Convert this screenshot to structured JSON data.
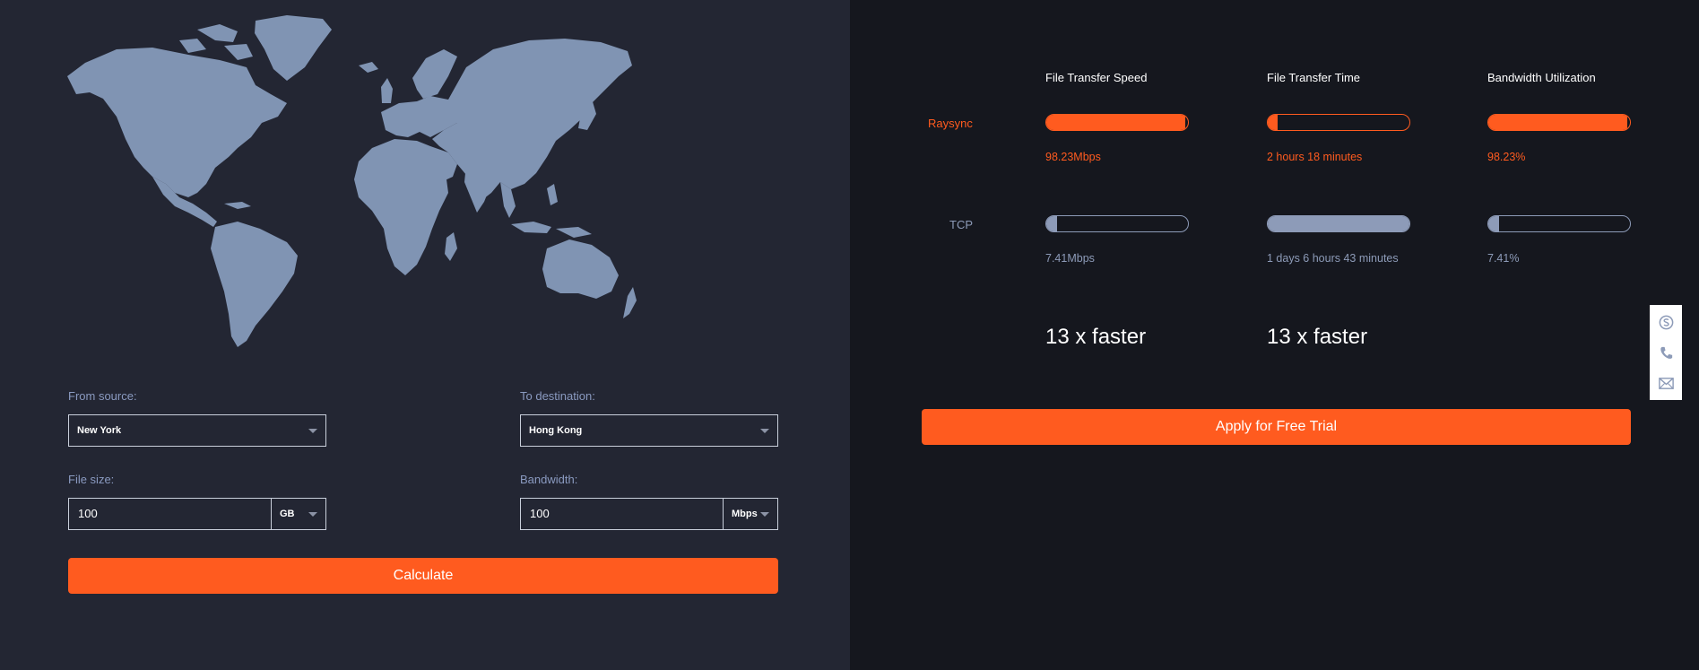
{
  "form": {
    "source_label": "From source:",
    "source_value": "New York",
    "destination_label": "To destination:",
    "destination_value": "Hong Kong",
    "filesize_label": "File size:",
    "filesize_value": "100",
    "filesize_unit": "GB",
    "bandwidth_label": "Bandwidth:",
    "bandwidth_value": "100",
    "bandwidth_unit": "Mbps",
    "calculate_label": "Calculate"
  },
  "results": {
    "columns": [
      "File Transfer Speed",
      "File Transfer Time",
      "Bandwidth Utilization"
    ],
    "raysync": {
      "label": "Raysync",
      "speed": "98.23Mbps",
      "time": "2 hours 18 minutes",
      "utilization": "98.23%",
      "speed_fill": 0.9823,
      "time_fill": 0.07,
      "utilization_fill": 0.9823
    },
    "tcp": {
      "label": "TCP",
      "speed": "7.41Mbps",
      "time": "1 days 6 hours 43 minutes",
      "utilization": "7.41%",
      "speed_fill": 0.0741,
      "time_fill": 1.0,
      "utilization_fill": 0.0741
    },
    "faster_speed": "13 x faster",
    "faster_time": "13 x faster",
    "trial_label": "Apply for Free Trial"
  },
  "side_icons": [
    "skype-icon",
    "phone-icon",
    "mail-icon"
  ],
  "colors": {
    "accent": "#ff5b1f",
    "left_bg": "#232633",
    "right_bg": "#15171e",
    "map_fill": "#8094b3",
    "tcp_bar": "#8d9bb8"
  }
}
